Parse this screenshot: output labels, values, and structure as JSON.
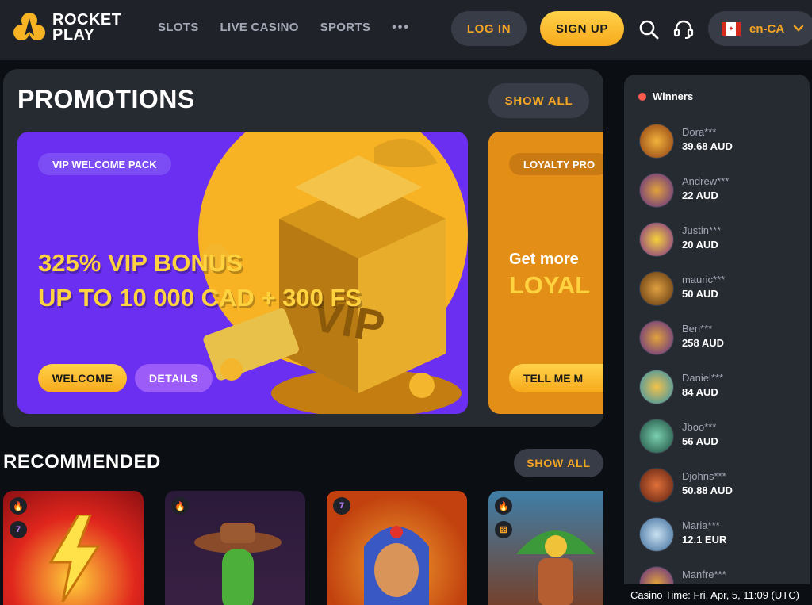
{
  "logo": {
    "line1": "ROCKET",
    "line2": "PLAY"
  },
  "nav": {
    "slots": "SLOTS",
    "live_casino": "LIVE CASINO",
    "sports": "SPORTS",
    "more": "•••"
  },
  "header": {
    "login": "LOG IN",
    "signup": "SIGN UP",
    "language": "en-CA"
  },
  "promotions": {
    "title": "PROMOTIONS",
    "show_all": "SHOW ALL",
    "cards": [
      {
        "tag": "VIP WELCOME PACK",
        "line1": "325% VIP BONUS",
        "line2": "UP TO 10 000 CAD + 300 FS",
        "primary": "WELCOME",
        "secondary": "DETAILS"
      },
      {
        "tag": "LOYALTY PRO",
        "line1": "Get more",
        "line2": "LOYAL",
        "primary": "TELL ME M"
      }
    ]
  },
  "recommended": {
    "title": "RECOMMENDED",
    "show_all": "SHOW ALL"
  },
  "winners": {
    "title": "Winners",
    "items": [
      {
        "name": "Dora***",
        "amount": "39.68 AUD"
      },
      {
        "name": "Andrew***",
        "amount": "22 AUD"
      },
      {
        "name": "Justin***",
        "amount": "20 AUD"
      },
      {
        "name": "mauric***",
        "amount": "50 AUD"
      },
      {
        "name": "Ben***",
        "amount": "258 AUD"
      },
      {
        "name": "Daniel***",
        "amount": "84 AUD"
      },
      {
        "name": "Jboo***",
        "amount": "56 AUD"
      },
      {
        "name": "Djohns***",
        "amount": "50.88 AUD"
      },
      {
        "name": "Maria***",
        "amount": "12.1 EUR"
      },
      {
        "name": "Manfre***",
        "amount": ""
      }
    ]
  },
  "casino_time": "Casino Time: Fri, Apr, 5, 11:09 (UTC)",
  "colors": {
    "accent": "#f5a524",
    "panel": "#262a31",
    "header": "#1f2229",
    "promo_purple": "#6a2ff0"
  }
}
